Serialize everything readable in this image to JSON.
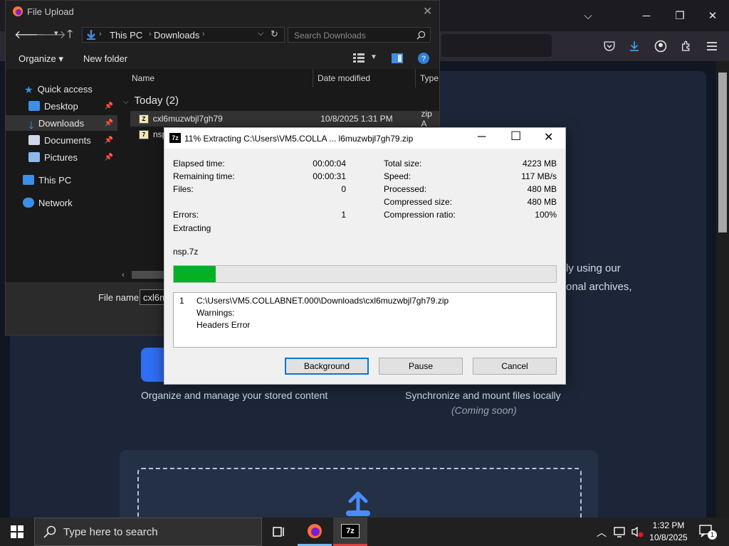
{
  "browser": {
    "window_controls": {
      "minimize": "─",
      "restore": "❐",
      "close": "✕"
    },
    "tab_list_chevron": "⌵"
  },
  "page": {
    "right_text_line1": "ly using our",
    "right_text_line2": "onal archives,",
    "feature_left_caption": "Organize and manage your stored content",
    "feature_right_caption": "Synchronize and mount files locally",
    "feature_right_note": "(Coming soon)"
  },
  "file_upload": {
    "title": "File Upload",
    "address": {
      "crumb1": "This PC",
      "crumb2": "Downloads"
    },
    "search_placeholder": "Search Downloads",
    "toolbar": {
      "organize": "Organize ▾",
      "new_folder": "New folder"
    },
    "nav": [
      {
        "label": "Quick access",
        "icon": "star-icon"
      },
      {
        "label": "Desktop",
        "icon": "desktop-icon",
        "pinned": true
      },
      {
        "label": "Downloads",
        "icon": "download-icon",
        "pinned": true
      },
      {
        "label": "Documents",
        "icon": "documents-icon",
        "pinned": true
      },
      {
        "label": "Pictures",
        "icon": "pictures-icon",
        "pinned": true
      },
      {
        "label": "This PC",
        "icon": "computer-icon"
      },
      {
        "label": "Network",
        "icon": "network-icon"
      }
    ],
    "columns": {
      "name": "Name",
      "date": "Date modified",
      "type": "Type"
    },
    "group_label": "Today (2)",
    "files": [
      {
        "name": "cxl6muzwbjl7gh79",
        "date": "10/8/2025 1:31 PM",
        "type": "zip A"
      },
      {
        "name": "nsp",
        "date": "",
        "type": ""
      }
    ],
    "file_name_label": "File name:",
    "file_name_value": "cxl6m"
  },
  "zip": {
    "title": "11% Extracting C:\\Users\\VM5.COLLA ... l6muzwbjl7gh79.zip",
    "stats_left": [
      {
        "label": "Elapsed time:",
        "value": "00:00:04"
      },
      {
        "label": "Remaining time:",
        "value": "00:00:31"
      },
      {
        "label": "Files:",
        "value": "0"
      },
      {
        "label": "Errors:",
        "value": "1"
      }
    ],
    "stats_right": [
      {
        "label": "Total size:",
        "value": "4223 MB"
      },
      {
        "label": "Speed:",
        "value": "117 MB/s"
      },
      {
        "label": "Processed:",
        "value": "480 MB"
      },
      {
        "label": "Compressed size:",
        "value": "480 MB"
      },
      {
        "label": "Compression ratio:",
        "value": "100%"
      }
    ],
    "status": "Extracting",
    "current_file": "nsp.7z",
    "progress_percent": 11,
    "log": {
      "index": "1",
      "path": "C:\\Users\\VM5.COLLABNET.000\\Downloads\\cxl6muzwbjl7gh79.zip",
      "line2": "Warnings:",
      "line3": "Headers Error"
    },
    "buttons": {
      "background": "Background",
      "pause": "Pause",
      "cancel": "Cancel"
    }
  },
  "taskbar": {
    "search_placeholder": "Type here to search",
    "clock_time": "1:32 PM",
    "clock_date": "10/8/2025",
    "notification_count": "1"
  }
}
